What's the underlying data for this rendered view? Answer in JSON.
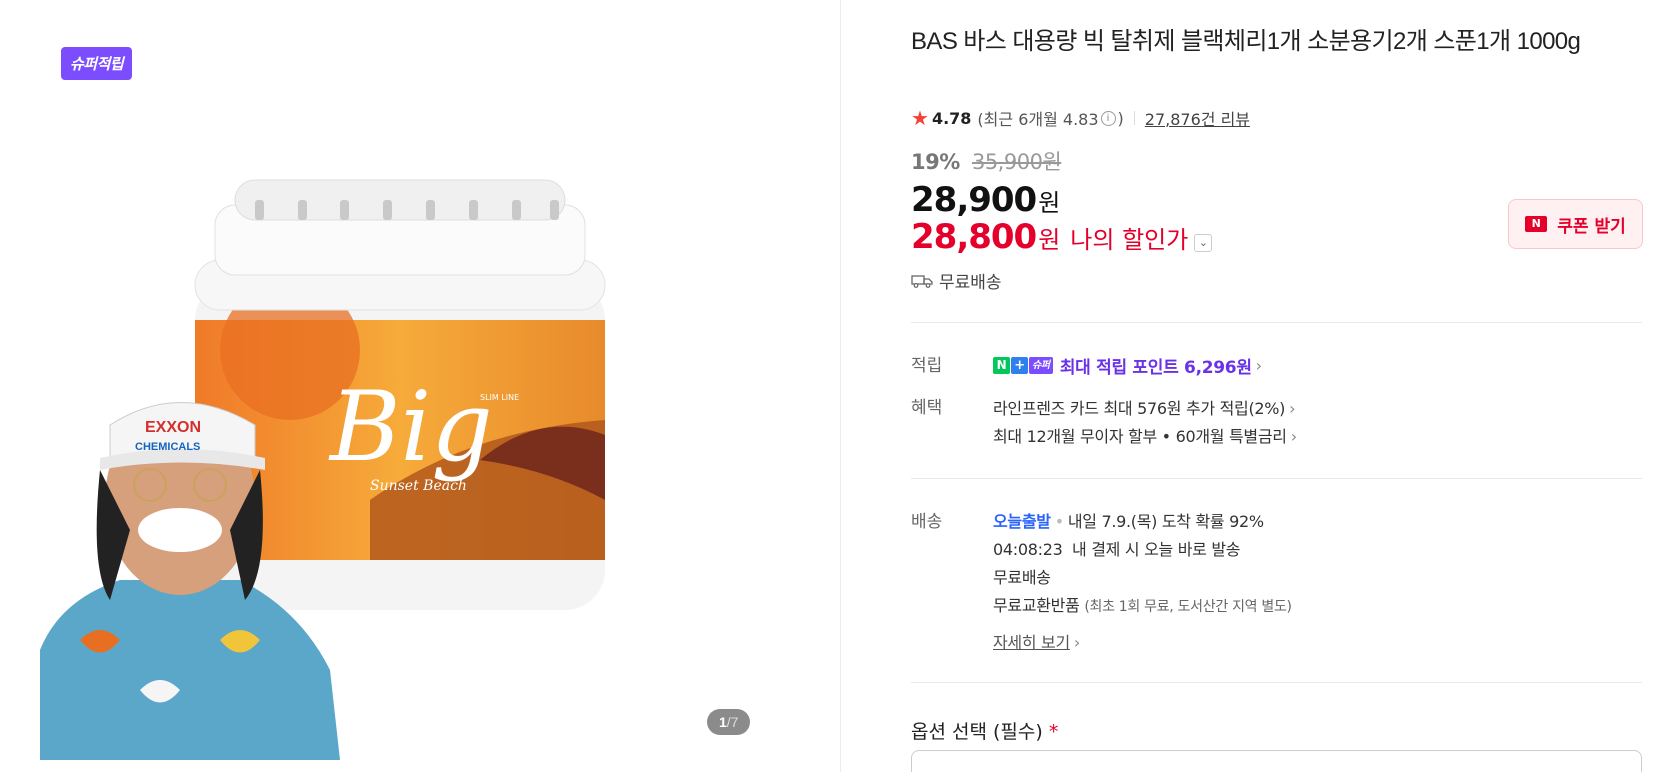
{
  "gallery": {
    "badge": "슈퍼적립",
    "pager_current": "1",
    "pager_total": "/7",
    "jar_logo": "Big",
    "jar_subtitle": "Sunset Beach",
    "jar_tag": "SLIM LINE",
    "cap_text_1": "EXXON",
    "cap_text_2": "CHEMICALS"
  },
  "product": {
    "title": "BAS 바스 대용량 빅 탈취제 블랙체리1개 소분용기2개 스푼1개 1000g",
    "rating": "4.78",
    "recent_rating": "(최근 6개월 4.83",
    "recent_close": ")",
    "reviews": "27,876건 리뷰",
    "discount_pct": "19%",
    "original_price": "35,900원",
    "price": "28,900",
    "price_unit": "원",
    "my_price": "28,800",
    "my_price_unit": "원",
    "my_price_label": "나의 할인가",
    "free_shipping_top": "무료배송",
    "coupon_button": "쿠폰 받기"
  },
  "details": {
    "points_label": "적립",
    "points_text": "최대 적립 포인트 6,296원",
    "benefits_label": "혜택",
    "benefit_1": "라인프렌즈 카드 최대 576원 추가 적립(2%)",
    "benefit_2": "최대 12개월 무이자 할부 • 60개월 특별금리",
    "delivery_label": "배송",
    "today_ship": "오늘출발",
    "arrival": "내일 7.9.(목) 도착 확률 92%",
    "countdown": "04:08:23",
    "countdown_text": "내 결제 시 오늘 바로 발송",
    "free_shipping": "무료배송",
    "free_return": "무료교환반품",
    "free_return_note": "(최초 1회 무료, 도서산간 지역 별도)",
    "detail_link": "자세히 보기",
    "option_label": "옵션 선택 (필수)",
    "option_required": "*"
  }
}
